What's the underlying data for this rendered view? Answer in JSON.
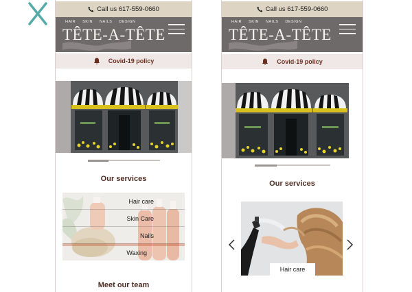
{
  "left": {
    "call_label": "Call us 617-559-0660",
    "logo": {
      "tags": [
        "HAIR",
        "SKIN",
        "NAILS",
        "DESIGN"
      ],
      "name": "TÊTE-A-TÊTE"
    },
    "covid_label": "Covid-19 policy",
    "services_title": "Our services",
    "services": [
      "Hair care",
      "Skin Care",
      "Nails",
      "Waxing"
    ],
    "meet_title": "Meet our team"
  },
  "right": {
    "call_label": "Call us 617-559-0660",
    "logo": {
      "tags": [
        "HAIR",
        "SKIN",
        "NAILS",
        "DESIGN"
      ],
      "name": "TÊTE-A-TÊTE"
    },
    "covid_label": "Covid-19 policy",
    "services_title": "Our services",
    "carousel_caption": "Hair care"
  },
  "colors": {
    "call_bar": "#ddd4c4",
    "header": "#6e6a69",
    "covid_bar": "#efe8e6",
    "accent_text": "#4f2e25",
    "reject_mark": "#56aaa8"
  },
  "icons": {
    "reject": "x-mark-icon",
    "phone": "phone-icon",
    "bell": "bell-icon",
    "menu": "hamburger-menu-icon",
    "prev": "chevron-left-icon",
    "next": "chevron-right-icon"
  }
}
